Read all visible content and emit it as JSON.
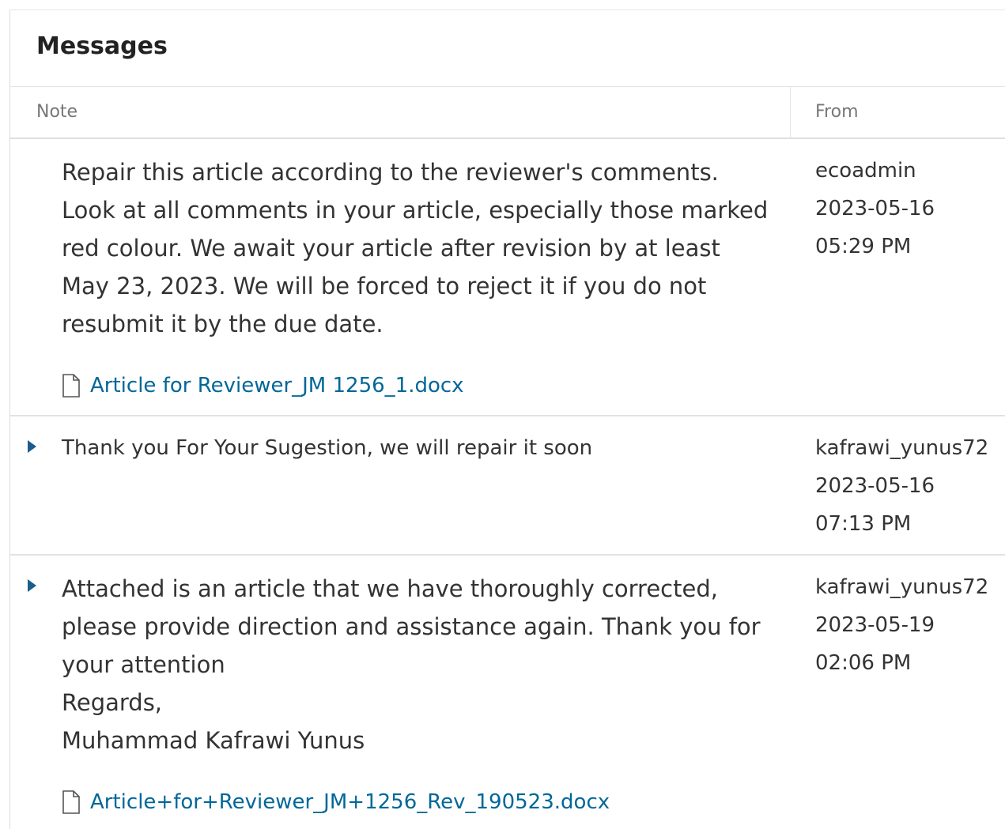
{
  "panel": {
    "title": "Messages"
  },
  "columns": {
    "note": "Note",
    "from": "From"
  },
  "messages": [
    {
      "text": "Repair this article according to the reviewer's comments. Look at all comments in your article, especially those marked red colour. We await your article after revision by at least May 23, 2023. We will be forced to reject it if you do not resubmit it by the due date.",
      "attachment": "Article for Reviewer_JM 1256_1.docx",
      "from_user": "ecoadmin",
      "date": "2023-05-16",
      "time": "05:29 PM"
    },
    {
      "text": "Thank you For Your Sugestion,  we will repair it soon",
      "from_user": "kafrawi_yunus72",
      "date": "2023-05-16",
      "time": "07:13 PM"
    },
    {
      "text": "Attached is an article that we have thoroughly corrected, please provide direction and assistance again. Thank you for your attention\nRegards,\nMuhammad Kafrawi Yunus",
      "attachment": "Article+for+Reviewer_JM+1256_Rev_190523.docx",
      "from_user": "kafrawi_yunus72",
      "date": "2023-05-19",
      "time": "02:06 PM"
    }
  ],
  "icons": {
    "toggle": "triangle-right-icon",
    "file": "document-icon"
  },
  "colors": {
    "link": "#006798",
    "toggle": "#1a5d8c",
    "text": "#333333",
    "header_text": "#777777"
  }
}
